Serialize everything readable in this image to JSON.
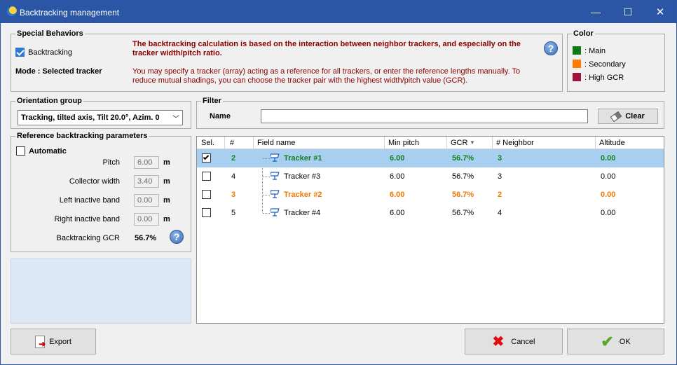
{
  "window": {
    "title": "Backtracking management",
    "minimize": "—",
    "maximize": "☐",
    "close": "✕"
  },
  "special": {
    "title": "Special Behaviors",
    "backtracking_label": "Backtracking",
    "mode_label": "Mode : Selected tracker",
    "info_bold": "The backtracking calculation is based on the interaction between neighbor trackers, and especially on the tracker width/pitch ratio.",
    "info_text": "You may specify a tracker (array) acting as a reference for all trackers, or enter the reference lengths manually. To reduce mutual shadings, you can choose the tracker pair with the highest width/pitch value (GCR)."
  },
  "color": {
    "title": "Color",
    "items": [
      {
        "label": ": Main",
        "hex": "#0e7a16"
      },
      {
        "label": ": Secondary",
        "hex": "#ff7a00"
      },
      {
        "label": ": High GCR",
        "hex": "#a0143c"
      }
    ]
  },
  "orientation": {
    "title": "Orientation group",
    "value": "Tracking, tilted axis, Tilt 20.0°, Azim. 0"
  },
  "params": {
    "title": "Reference backtracking parameters",
    "automatic_label": "Automatic",
    "pitch_label": "Pitch",
    "pitch_value": "6.00",
    "pitch_unit": "m",
    "collector_label": "Collector width",
    "collector_value": "3.40",
    "collector_unit": "m",
    "left_label": "Left inactive band",
    "left_value": "0.00",
    "left_unit": "m",
    "right_label": "Right inactive band",
    "right_value": "0.00",
    "right_unit": "m",
    "gcr_label": "Backtracking GCR",
    "gcr_value": "56.7%"
  },
  "filter": {
    "title": "Filter",
    "name_label": "Name",
    "name_value": "",
    "clear_label": "Clear"
  },
  "table": {
    "headers": [
      "Sel.",
      "#",
      "Field name",
      "Min pitch",
      "GCR",
      "# Neighbor",
      "Altitude"
    ],
    "rows": [
      {
        "sel": true,
        "num": "2",
        "name": "Tracker #1",
        "pitch": "6.00",
        "gcr": "56.7%",
        "neighbor": "3",
        "altitude": "0.00"
      },
      {
        "sel": false,
        "num": "4",
        "name": "Tracker #3",
        "pitch": "6.00",
        "gcr": "56.7%",
        "neighbor": "3",
        "altitude": "0.00"
      },
      {
        "sel": false,
        "num": "3",
        "name": "Tracker #2",
        "pitch": "6.00",
        "gcr": "56.7%",
        "neighbor": "2",
        "altitude": "0.00"
      },
      {
        "sel": false,
        "num": "5",
        "name": "Tracker #4",
        "pitch": "6.00",
        "gcr": "56.7%",
        "neighbor": "4",
        "altitude": "0.00"
      }
    ]
  },
  "buttons": {
    "export": "Export",
    "cancel": "Cancel",
    "ok": "OK"
  }
}
